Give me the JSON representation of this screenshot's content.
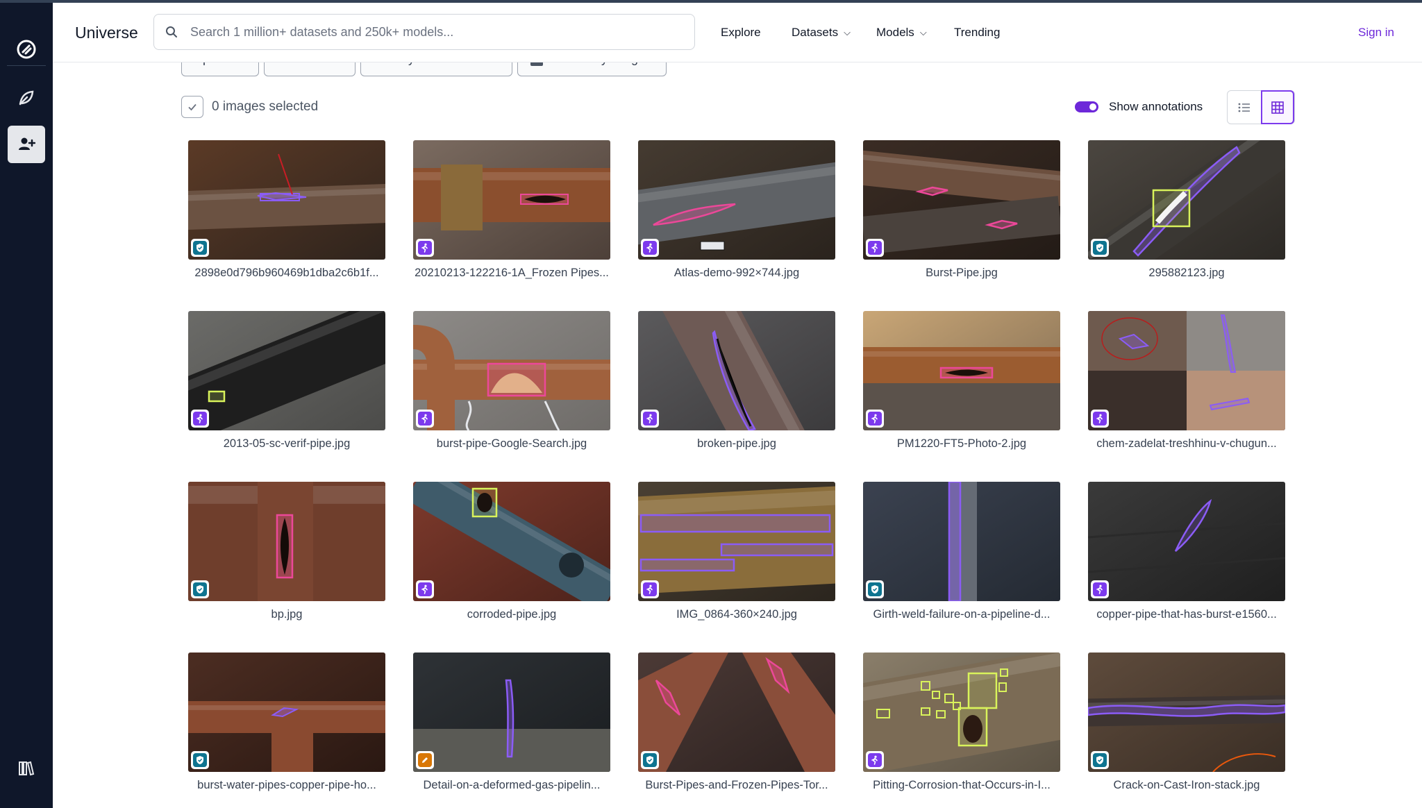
{
  "header": {
    "brand": "Universe",
    "search_placeholder": "Search 1 million+ datasets and 250k+ models...",
    "nav": {
      "explore": "Explore",
      "datasets": "Datasets",
      "models": "Models",
      "trending": "Trending"
    },
    "signin": "Sign in"
  },
  "rail": {
    "icons": [
      "roboflow-logo-icon",
      "leaf-icon",
      "add-user-icon",
      "library-icon"
    ]
  },
  "filters": {
    "split": "Split",
    "classes": "Classes",
    "sort": "Sort By  Newest",
    "search_image": "Search by image"
  },
  "selection": {
    "count_text": "0 images selected",
    "show_annotations": "Show annotations",
    "show_annotations_on": true
  },
  "colors": {
    "accent": "#6d28d9",
    "rail": "#0f172a",
    "annotation_purple": "#8b5cf6",
    "annotation_pink": "#ec4899",
    "annotation_yellow": "#d9f35b"
  },
  "images": [
    {
      "name": "2898e0d796b960469b1dba2c6b1f...",
      "badge": "verified"
    },
    {
      "name": "20210213-122216-1A_Frozen Pipes...",
      "badge": "walk"
    },
    {
      "name": "Atlas-demo-992×744.jpg",
      "badge": "walk"
    },
    {
      "name": "Burst-Pipe.jpg",
      "badge": "walk"
    },
    {
      "name": "295882123.jpg",
      "badge": "verified"
    },
    {
      "name": "2013-05-sc-verif-pipe.jpg",
      "badge": "walk"
    },
    {
      "name": "burst-pipe-Google-Search.jpg",
      "badge": "walk"
    },
    {
      "name": "broken-pipe.jpg",
      "badge": "walk"
    },
    {
      "name": "PM1220-FT5-Photo-2.jpg",
      "badge": "walk"
    },
    {
      "name": "chem-zadelat-treshhinu-v-chugun...",
      "badge": "walk"
    },
    {
      "name": "bp.jpg",
      "badge": "verified"
    },
    {
      "name": "corroded-pipe.jpg",
      "badge": "walk"
    },
    {
      "name": "IMG_0864-360×240.jpg",
      "badge": "walk"
    },
    {
      "name": "Girth-weld-failure-on-a-pipeline-d...",
      "badge": "verified"
    },
    {
      "name": "copper-pipe-that-has-burst-e1560...",
      "badge": "walk"
    },
    {
      "name": "burst-water-pipes-copper-pipe-ho...",
      "badge": "verified"
    },
    {
      "name": "Detail-on-a-deformed-gas-pipelin...",
      "badge": "edit"
    },
    {
      "name": "Burst-Pipes-and-Frozen-Pipes-Tor...",
      "badge": "verified"
    },
    {
      "name": "Pitting-Corrosion-that-Occurs-in-I...",
      "badge": "walk"
    },
    {
      "name": "Crack-on-Cast-Iron-stack.jpg",
      "badge": "verified"
    }
  ]
}
